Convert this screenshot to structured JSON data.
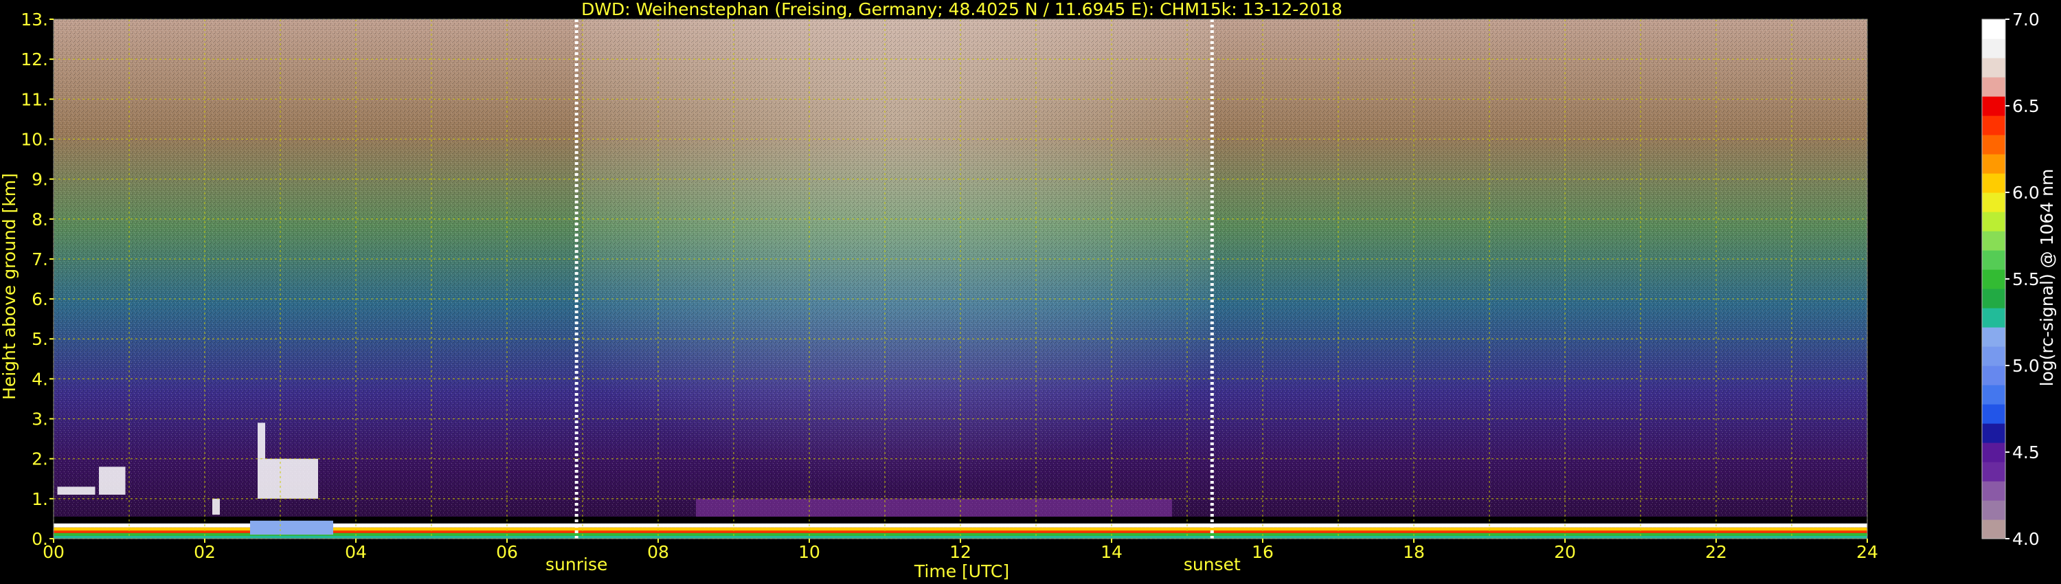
{
  "chart_data": {
    "type": "heatmap",
    "title": "DWD: Weihenstephan (Freising, Germany; 48.4025 N / 11.6945 E):    CHM15k: 13-12-2018",
    "xlabel": "Time [UTC]",
    "ylabel": "Height above ground [km]",
    "xlim": [
      0,
      24
    ],
    "ylim": [
      0,
      13
    ],
    "x_ticks": [
      "00",
      "02",
      "04",
      "06",
      "08",
      "10",
      "12",
      "14",
      "16",
      "18",
      "20",
      "22",
      "24"
    ],
    "y_ticks": [
      "0.",
      "1.",
      "2.",
      "3.",
      "4.",
      "5.",
      "6.",
      "7.",
      "8.",
      "9.",
      "10.",
      "11.",
      "12.",
      "13."
    ],
    "grid": true,
    "events": [
      {
        "label": "sunrise",
        "x": 6.92
      },
      {
        "label": "sunset",
        "x": 15.33
      }
    ],
    "colorbar": {
      "label": "log(rc-signal) @ 1064 nm",
      "min": 4.0,
      "max": 7.0,
      "ticks": [
        "4.0",
        "4.5",
        "5.0",
        "5.5",
        "6.0",
        "6.5",
        "7.0"
      ],
      "colors": [
        "#b59a9a",
        "#9a7aa6",
        "#8a5aa6",
        "#6a2aa0",
        "#5a1a9a",
        "#1a1aa0",
        "#2255e8",
        "#4477ee",
        "#6688ee",
        "#7799ee",
        "#88aaee",
        "#22bb99",
        "#22aa44",
        "#33bb33",
        "#55cc55",
        "#88dd55",
        "#bbee33",
        "#eeee22",
        "#ffcc00",
        "#ff9900",
        "#ff6600",
        "#ff3300",
        "#ee0000",
        "#e8a8a0",
        "#e8d8d0",
        "#f2f2f2",
        "#ffffff"
      ]
    }
  }
}
